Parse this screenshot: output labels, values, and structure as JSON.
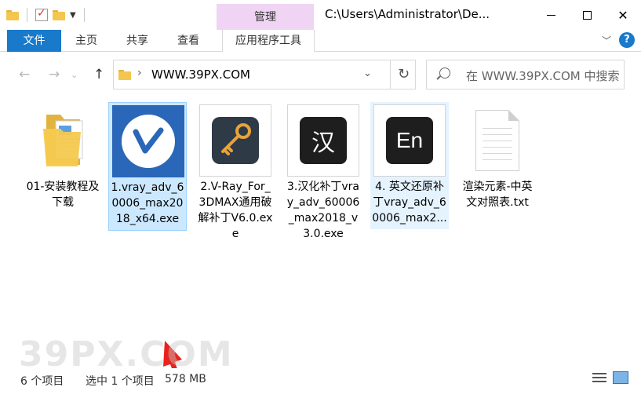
{
  "titlebar": {
    "manage_tab": "管理",
    "title": "C:\\Users\\Administrator\\De..."
  },
  "ribbon": {
    "file_tab": "文件",
    "tabs": [
      "主页",
      "共享",
      "查看"
    ],
    "app_tools_tab": "应用程序工具"
  },
  "address": {
    "path": "WWW.39PX.COM"
  },
  "search": {
    "placeholder": "在 WWW.39PX.COM 中搜索"
  },
  "files": [
    {
      "name": "01-安装教程及下载",
      "type": "folder-icon"
    },
    {
      "name": "1.vray_adv_60006_max2018_x64.exe",
      "type": "vray-icon",
      "state": "selected"
    },
    {
      "name": "2.V-Ray_For_3DMAX通用破解补丁V6.0.exe",
      "type": "key-icon"
    },
    {
      "name": "3.汉化补丁vray_adv_60006_max2018_v3.0.exe",
      "type": "chinese-patch-icon",
      "glyph": "汉"
    },
    {
      "name": "4. 英文还原补丁vray_adv_60006_max2...",
      "type": "english-patch-icon",
      "glyph": "En",
      "state": "hovered"
    },
    {
      "name": "渲染元素-中英文对照表.txt",
      "type": "txt-icon"
    }
  ],
  "watermark": "39PX.COM",
  "status": {
    "count": "6 个项目",
    "selected": "选中 1 个项目",
    "size": "578 MB"
  },
  "colors": {
    "accent": "#1979ca",
    "manage_tab_bg": "#f0d4f3",
    "selection_bg": "#cce8ff",
    "arrow": "#e8231e",
    "vray_blue": "#2a67b8"
  }
}
